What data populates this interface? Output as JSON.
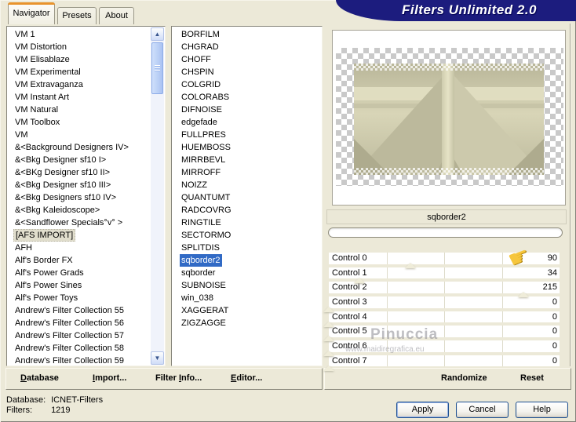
{
  "window": {
    "title": "Filters Unlimited 2.0"
  },
  "tabs": [
    {
      "label": "Navigator",
      "active": true
    },
    {
      "label": "Presets",
      "active": false
    },
    {
      "label": "About",
      "active": false
    }
  ],
  "category_list": {
    "highlighted_index": 16,
    "items": [
      "VM 1",
      "VM Distortion",
      "VM Elisablaze",
      "VM Experimental",
      "VM Extravaganza",
      "VM Instant Art",
      "VM Natural",
      "VM Toolbox",
      "VM",
      "&<Background Designers IV>",
      "&<Bkg Designer sf10 I>",
      "&<BKg Designer sf10 II>",
      "&<Bkg Designer sf10 III>",
      "&<Bkg Designers sf10 IV>",
      "&<Bkg Kaleidoscope>",
      "&<Sandflower Specials°v° >",
      "[AFS IMPORT]",
      "AFH",
      "Alf's Border FX",
      "Alf's Power Grads",
      "Alf's Power Sines",
      "Alf's Power Toys",
      "Andrew's Filter Collection 55",
      "Andrew's Filter Collection 56",
      "Andrew's Filter Collection 57",
      "Andrew's Filter Collection 58",
      "Andrew's Filter Collection 59"
    ]
  },
  "filter_list": {
    "selected_index": 18,
    "items": [
      "BORFILM",
      "CHGRAD",
      "CHOFF",
      "CHSPIN",
      "COLGRID",
      "COLORABS",
      "DIFNOISE",
      "edgefade",
      "FULLPRES",
      "HUEMBOSS",
      "MIRRBEVL",
      "MIRROFF",
      "NOIZZ",
      "QUANTUMT",
      "RADCOVRG",
      "RINGTILE",
      "SECTORMO",
      "SPLITDIS",
      "sqborder2",
      "sqborder",
      "SUBNOISE",
      "win_038",
      "XAGGERAT",
      "ZIGZAGGE"
    ]
  },
  "preview": {
    "caption": "sqborder2",
    "progress_value": 0
  },
  "slider": {
    "max": 255
  },
  "controls": [
    {
      "label": "Control 0",
      "value": 90
    },
    {
      "label": "Control 1",
      "value": 34
    },
    {
      "label": "Control 2",
      "value": 215
    },
    {
      "label": "Control 3",
      "value": 0
    },
    {
      "label": "Control 4",
      "value": 0
    },
    {
      "label": "Control 5",
      "value": 0
    },
    {
      "label": "Control 6",
      "value": 0
    },
    {
      "label": "Control 7",
      "value": 0
    }
  ],
  "command_bar": [
    {
      "pre": "",
      "key": "D",
      "post": "atabase"
    },
    {
      "pre": "",
      "key": "I",
      "post": "mport..."
    },
    {
      "pre": "Filter ",
      "key": "I",
      "post": "nfo..."
    },
    {
      "pre": "",
      "key": "E",
      "post": "ditor..."
    }
  ],
  "action_bar": {
    "randomize": "Randomize",
    "reset": "Reset"
  },
  "status": {
    "database_label": "Database:",
    "database_value": "ICNET-Filters",
    "filters_label": "Filters:",
    "filters_value": "1219"
  },
  "buttons": {
    "apply": "Apply",
    "cancel": "Cancel",
    "help": "Help"
  },
  "watermark": {
    "line1": "Pinuccia",
    "line2": "www.maidiregrafica.eu"
  },
  "icons": {
    "arrow_up": "▲",
    "arrow_down": "▼",
    "pointer_hand": "☛"
  },
  "colors": {
    "banner_navy": "#1c1c7e",
    "selection_blue": "#316ac5",
    "tab_accent_orange": "#e8932c",
    "dialog_beige": "#ece9d8",
    "hand_yellow": "#f6c63d"
  }
}
